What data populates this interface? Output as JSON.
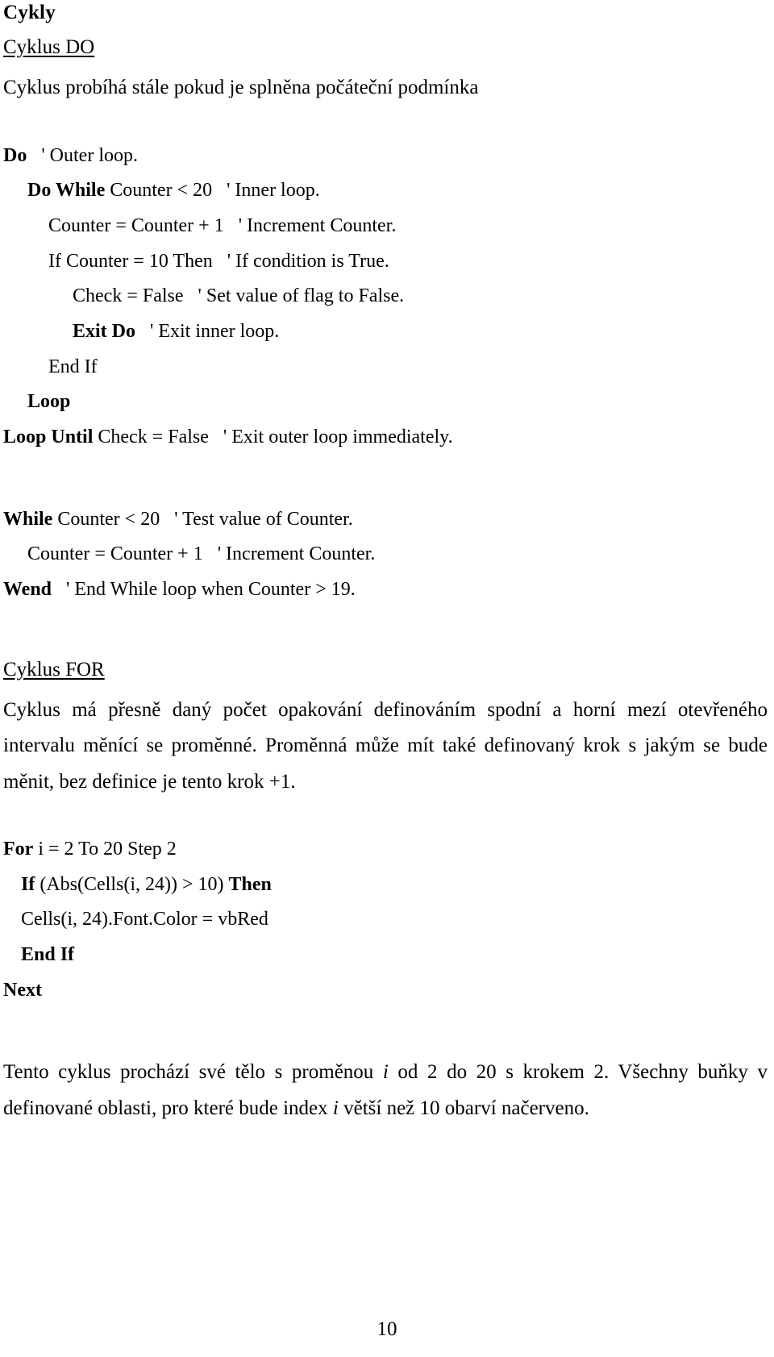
{
  "document": {
    "title": "Cykly",
    "page_number": "10",
    "sections": [
      {
        "id": "cyklus-do",
        "heading": "Cyklus DO",
        "intro": "Cyklus probíhá stále pokud je splněna počáteční podmínka"
      },
      {
        "id": "cyklus-for",
        "heading": "Cyklus FOR",
        "intro": "Cyklus má přesně daný počet opakování definováním spodní a horní mezí otevřeného intervalu měnící se proměnné. Proměnná může mít také definovaný krok s jakým se bude měnit, bez definice je tento krok +1."
      }
    ]
  },
  "code_do": {
    "lines": [
      {
        "indent": 0,
        "keyword": "Do",
        "rest": "",
        "comment": "' Outer loop."
      },
      {
        "indent": 30,
        "keyword": "Do While",
        "rest": " Counter < 20",
        "comment": "' Inner loop."
      },
      {
        "indent": 56,
        "keyword": "",
        "rest": "Counter = Counter + 1",
        "comment": "' Increment Counter."
      },
      {
        "indent": 56,
        "keyword": "",
        "rest": "If Counter = 10 Then",
        "comment": "' If condition is True."
      },
      {
        "indent": 86,
        "keyword": "",
        "rest": "Check = False",
        "comment": "' Set value of flag to False."
      },
      {
        "indent": 86,
        "keyword": "Exit Do",
        "rest": "",
        "comment": "' Exit inner loop."
      },
      {
        "indent": 56,
        "keyword": "",
        "rest": "End If",
        "comment": ""
      },
      {
        "indent": 30,
        "keyword": "Loop",
        "rest": "",
        "comment": ""
      },
      {
        "indent": 0,
        "keyword": "Loop Until",
        "rest": " Check = False",
        "comment": "' Exit outer loop immediately."
      }
    ]
  },
  "code_while": {
    "lines": [
      {
        "indent": 0,
        "keyword": "While",
        "rest": " Counter < 20",
        "comment": "' Test value of Counter."
      },
      {
        "indent": 30,
        "keyword": "",
        "rest": "Counter = Counter + 1",
        "comment": "' Increment Counter."
      },
      {
        "indent": 0,
        "keyword": "Wend",
        "rest": "",
        "comment": "' End While loop when Counter > 19."
      }
    ]
  },
  "code_for": {
    "lines": [
      {
        "indent": 0,
        "pre_kw": "For",
        "mid": " i = 2 To 20 Step 2",
        "post_kw": ""
      },
      {
        "indent": 22,
        "pre_kw": "If",
        "mid": " (Abs(Cells(i, 24)) > 10) ",
        "post_kw": "Then"
      },
      {
        "indent": 22,
        "pre_kw": "",
        "mid": "Cells(i, 24).Font.Color = vbRed",
        "post_kw": ""
      },
      {
        "indent": 22,
        "pre_kw": "End If",
        "mid": "",
        "post_kw": ""
      },
      {
        "indent": 0,
        "pre_kw": "Next",
        "mid": "",
        "post_kw": ""
      }
    ]
  },
  "closing": {
    "line1_a": "Tento cyklus prochází své tělo s proměnou ",
    "line1_i": "i",
    "line1_b": " od 2 do 20 s krokem 2. Všechny buňky v definované oblasti, pro které bude index ",
    "line2_i": "i",
    "line2_b": " větší než 10 obarví načerveno."
  }
}
